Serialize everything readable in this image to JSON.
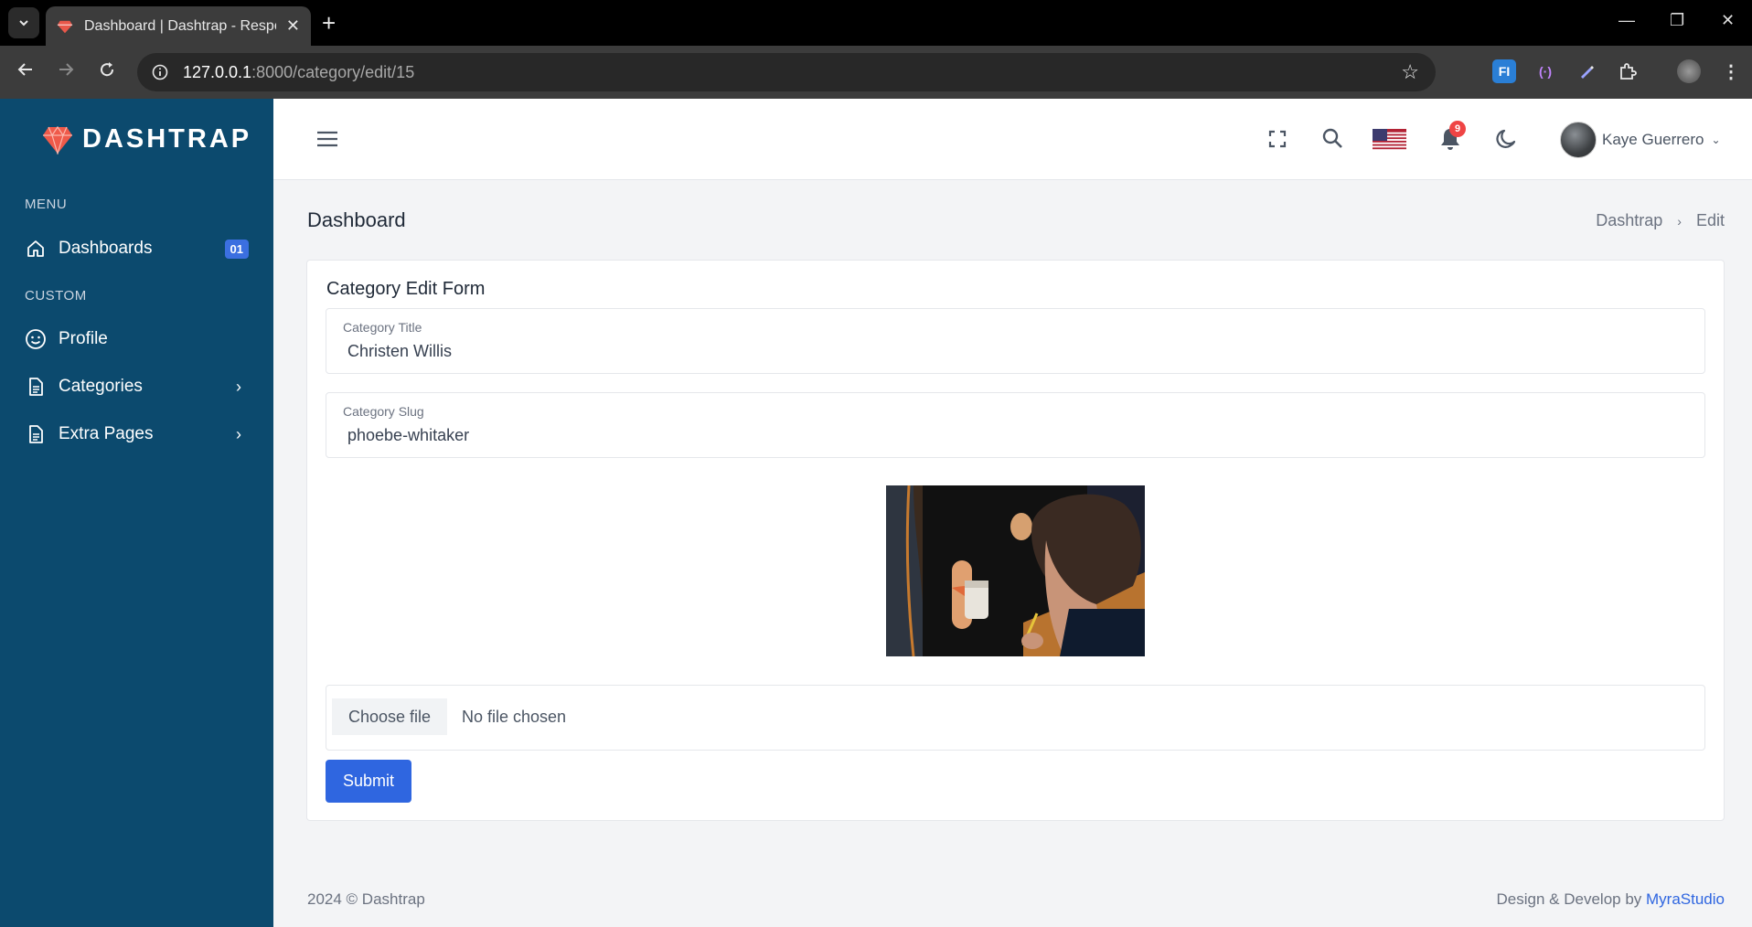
{
  "browser": {
    "tab_title": "Dashboard | Dashtrap - Respon",
    "url_host": "127.0.0.1",
    "url_rest": ":8000/category/edit/15"
  },
  "sidebar": {
    "logo_text": "DASHTRAP",
    "heading_menu": "MENU",
    "heading_custom": "CUSTOM",
    "items": [
      {
        "label": "Dashboards",
        "badge": "01",
        "icon": "home-icon"
      },
      {
        "label": "Profile",
        "icon": "smile-icon"
      },
      {
        "label": "Categories",
        "icon": "document-icon"
      },
      {
        "label": "Extra Pages",
        "icon": "document-icon"
      }
    ]
  },
  "topbar": {
    "notification_count": "9",
    "user_name": "Kaye Guerrero"
  },
  "page": {
    "title": "Dashboard",
    "breadcrumb": [
      "Dashtrap",
      "Edit"
    ]
  },
  "form": {
    "title": "Category Edit Form",
    "title_field": {
      "label": "Category Title",
      "value": "Christen Willis"
    },
    "slug_field": {
      "label": "Category Slug",
      "value": "phoebe-whitaker"
    },
    "file_button": "Choose file",
    "file_status": "No file chosen",
    "submit_label": "Submit"
  },
  "footer": {
    "left": "2024 © Dashtrap",
    "right_prefix": "Design & Develop by ",
    "right_link": "MyraStudio"
  },
  "colors": {
    "sidebar_bg": "#0c4a6e",
    "accent": "#2f66e0",
    "badge_red": "#ef4444"
  }
}
